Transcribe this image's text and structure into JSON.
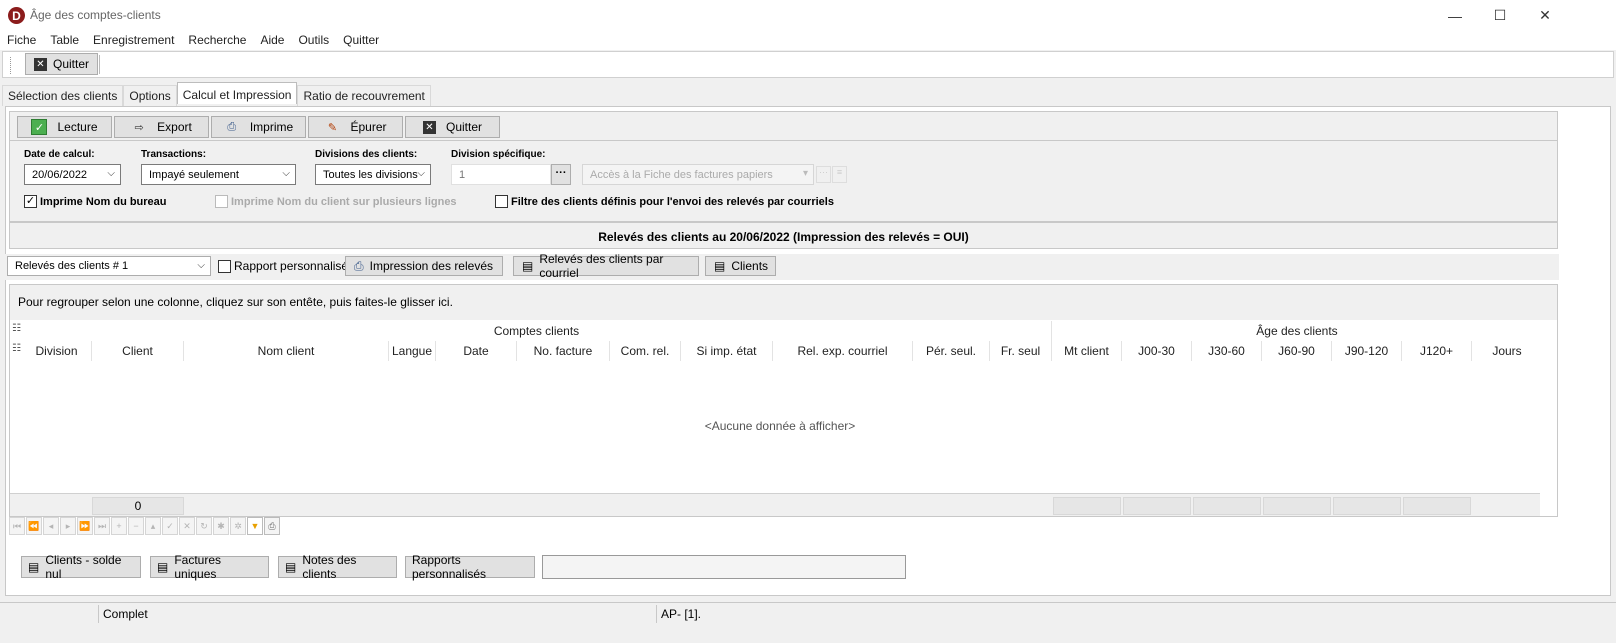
{
  "window": {
    "logo_letter": "D",
    "title": "Âge des comptes-clients",
    "minimize": "—",
    "maximize": "☐",
    "close": "✕"
  },
  "menu": [
    "Fiche",
    "Table",
    "Enregistrement",
    "Recherche",
    "Aide",
    "Outils",
    "Quitter"
  ],
  "toolbar": {
    "quit_label": "Quitter"
  },
  "tabs": [
    {
      "label": "Sélection des clients"
    },
    {
      "label": "Options"
    },
    {
      "label": "Calcul et Impression",
      "active": true
    },
    {
      "label": "Ratio de recouvrement"
    }
  ],
  "actions": {
    "lecture": "Lecture",
    "export": "Export",
    "imprime": "Imprime",
    "epurer": "Épurer",
    "quitter": "Quitter"
  },
  "params": {
    "date_label": "Date de calcul:",
    "date_value": "20/06/2022",
    "transactions_label": "Transactions:",
    "transactions_value": "Impayé seulement",
    "divisions_label": "Divisions des clients:",
    "divisions_value": "Toutes les divisions",
    "division_specific_label": "Division spécifique:",
    "division_specific_value": "1",
    "ellipsis": "···",
    "fiche_placeholder": "Accès à la Fiche des factures papiers",
    "chk_nom_bureau": "Imprime Nom du bureau",
    "chk_nom_bureau_checked": true,
    "chk_plusieurs_lignes": "Imprime Nom du client sur plusieurs lignes",
    "chk_filtre_courriels": "Filtre des clients définis pour l'envoi des relevés par courriels"
  },
  "banner": "Relevés des clients au 20/06/2022 (Impression des relevés = OUI)",
  "reportbar": {
    "report_select": "Relevés des clients # 1",
    "rapport_perso": "Rapport personnalisé",
    "impression_releves": "Impression des relevés",
    "releves_courriel": "Relevés des clients par courriel",
    "clients": "Clients"
  },
  "grid": {
    "group_hint": "Pour regrouper selon une colonne, cliquez sur son entête, puis faites-le glisser ici.",
    "band_comptes": "Comptes clients",
    "band_age": "Âge des clients",
    "columns": [
      "Division",
      "Client",
      "Nom client",
      "Langue",
      "Date",
      "No. facture",
      "Com. rel.",
      "Si imp. état",
      "Rel. exp. courriel",
      "Pér. seul.",
      "Fr. seul",
      "Mt client",
      "J00-30",
      "J30-60",
      "J60-90",
      "J90-120",
      "J120+",
      "Jours"
    ],
    "no_data": "<Aucune donnée à afficher>",
    "footer_count": "0"
  },
  "bottom_buttons": {
    "solde_nul": "Clients - solde nul",
    "factures_uniques": "Factures uniques",
    "notes_clients": "Notes des clients",
    "rapports_perso": "Rapports personnalisés"
  },
  "status": {
    "complet": "Complet",
    "ap": "AP- [1]."
  },
  "colors": {
    "logo": "#8b1c1c",
    "filter_icon": "#e8a000",
    "lecture_icon": "#4caf50"
  }
}
